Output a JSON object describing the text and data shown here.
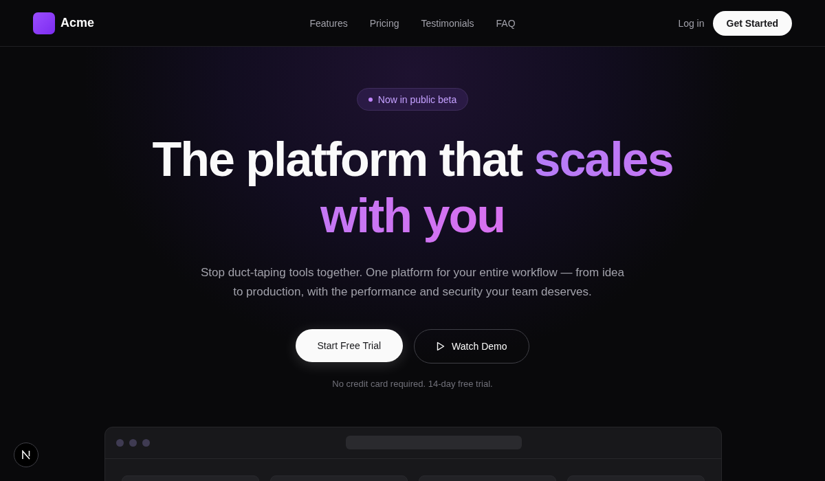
{
  "brand": {
    "name": "Acme"
  },
  "nav": {
    "links": [
      "Features",
      "Pricing",
      "Testimonials",
      "FAQ"
    ],
    "login": "Log in",
    "cta": "Get Started"
  },
  "hero": {
    "badge": "Now in public beta",
    "headline": {
      "text": "The platform that",
      "highlight": "scales with you"
    },
    "subtitle": "Stop duct-taping tools together. One platform for your entire workflow — from idea to production, with the performance and security your team deserves.",
    "primary_button": "Start Free Trial",
    "secondary_button": "Watch Demo",
    "note": "No credit card required. 14-day free trial."
  }
}
